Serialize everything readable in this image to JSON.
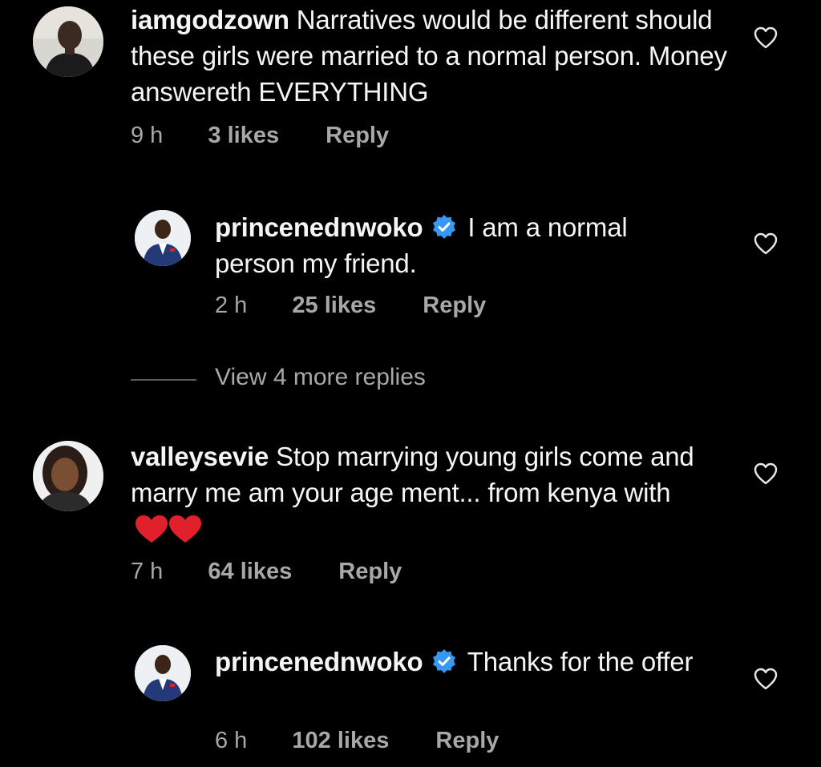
{
  "colors": {
    "background": "#000000",
    "text_primary": "#f5f5f5",
    "text_secondary": "#a8a8a8",
    "verified_blue": "#3897f0",
    "emoji_red": "#e0202a"
  },
  "icons": {
    "like": "heart-outline-icon",
    "verified": "verified-badge-icon",
    "emoji": "red-heart-emoji"
  },
  "comments": [
    {
      "username": "iamgodzown",
      "text": "Narratives would be different should these girls were married to a normal person. Money answereth EVERYTHING",
      "verified": false,
      "time": "9 h",
      "likes": "3 likes",
      "reply": "Reply"
    },
    {
      "username": "princenednwoko",
      "text": "I am a normal person my friend.",
      "verified": true,
      "time": "2 h",
      "likes": "25 likes",
      "reply": "Reply"
    },
    {
      "username": "valleysevie",
      "text": "Stop marrying young girls come and marry me am your age ment... from kenya with",
      "emoji": "❤❤",
      "verified": false,
      "time": "7 h",
      "likes": "64 likes",
      "reply": "Reply"
    },
    {
      "username": "princenednwoko",
      "text": "Thanks for the offer",
      "verified": true,
      "time": "6 h",
      "likes": "102 likes",
      "reply": "Reply"
    }
  ],
  "view_more": {
    "label": "View 4 more replies"
  }
}
